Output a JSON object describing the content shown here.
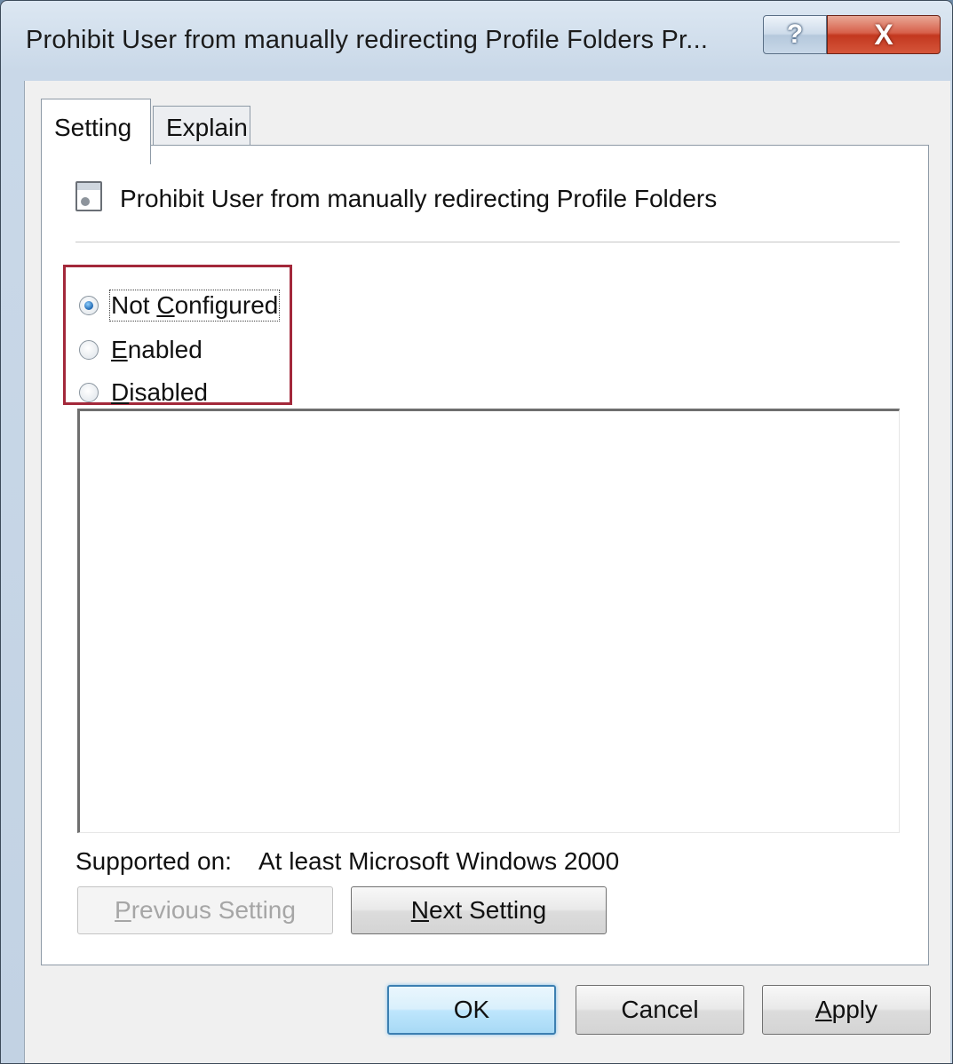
{
  "window": {
    "title": "Prohibit User from manually redirecting Profile Folders Pr...",
    "help_glyph": "?",
    "close_glyph": "X"
  },
  "tabs": [
    {
      "label": "Setting",
      "active": true
    },
    {
      "label": "Explain",
      "active": false
    }
  ],
  "policy": {
    "icon": "policy-setting-icon",
    "name": "Prohibit User from manually redirecting Profile Folders"
  },
  "options": [
    {
      "label": "Not Configured",
      "selected": true
    },
    {
      "label": "Enabled",
      "selected": false
    },
    {
      "label": "Disabled",
      "selected": false
    }
  ],
  "supported": {
    "label": "Supported on:",
    "value": "At least Microsoft Windows 2000"
  },
  "nav_buttons": {
    "previous": "Previous Setting",
    "next": "Next Setting"
  },
  "dialog_buttons": {
    "ok": "OK",
    "cancel": "Cancel",
    "apply": "Apply"
  },
  "colors": {
    "highlight_box": "#a3283a",
    "close_button": "#c3381f"
  }
}
